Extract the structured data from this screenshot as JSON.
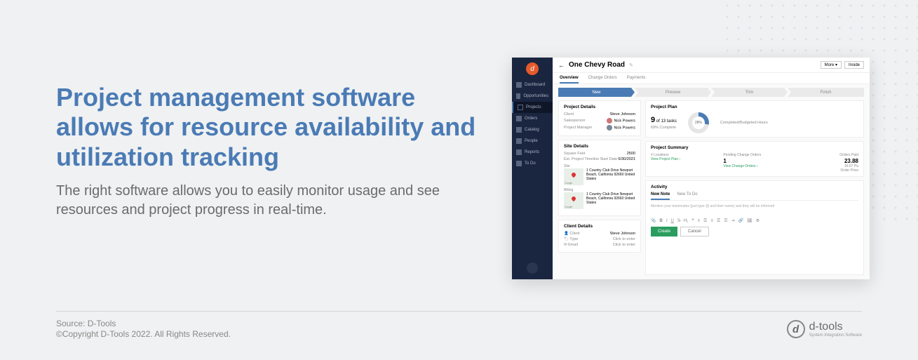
{
  "hero": {
    "headline": "Project management software allows for resource availability and utilization tracking",
    "subhead": "The right software allows you to easily monitor usage and see resources and project progress in real-time."
  },
  "sidebar": {
    "items": [
      {
        "label": "Dashboard"
      },
      {
        "label": "Opportunities"
      },
      {
        "label": "Projects"
      },
      {
        "label": "Orders"
      },
      {
        "label": "Catalog"
      },
      {
        "label": "People"
      },
      {
        "label": "Reports"
      },
      {
        "label": "To Do"
      }
    ]
  },
  "header": {
    "title": "One Chevy Road",
    "more": "More ▾",
    "inside": "Inside"
  },
  "tabs": {
    "overview": "Overview",
    "change_orders": "Change Orders",
    "payments": "Payments"
  },
  "stages": [
    "New",
    "Preview",
    "Trim",
    "Finish"
  ],
  "project_details": {
    "title": "Project Details",
    "client_label": "Client",
    "client": "Steve Johnson",
    "sales_label": "Salesperson",
    "sales": "Nick Powers",
    "pm_label": "Project Manager",
    "pm": "Nick Powers"
  },
  "site_details": {
    "title": "Site Details",
    "sqft_label": "Square Feet",
    "sqft": "2500",
    "timeline_label": "Est. Project Timeline",
    "start_label": "Start Date",
    "start": "6/30/2021",
    "site_label": "Site",
    "billing_label": "Billing",
    "address": "1 Country Club Drive Newport Beach, California 92660 United States",
    "google": "Google"
  },
  "client_details": {
    "title": "Client Details",
    "client_label": "Client",
    "client": "Steve Johnson",
    "type_label": "Type",
    "type": "Click to enter",
    "email_label": "Email",
    "email": "Click to enter"
  },
  "plan": {
    "title": "Project Plan",
    "tasks_done": "9",
    "tasks_mid": " of ",
    "tasks_total": "13 tasks",
    "percent": "69% Complete",
    "donut": "28%",
    "label": "Completed/Budgeted Hours"
  },
  "summary": {
    "title": "Project Summary",
    "loc_label": "# Locations",
    "loc_link": "View Project Plan",
    "pending_label": "Pending Change Orders",
    "pending_val": "1",
    "pending_link": "View Change Orders",
    "paid_label": "Orders Paid",
    "paid_val": "23.88",
    "paid_sub": "16.57 Pa",
    "paid_note": "Order Price"
  },
  "activity": {
    "title": "Activity",
    "tab_note": "New Note",
    "tab_todo": "New To Do",
    "hint": "Mention your teammates (just type @ and their name) and they will be informed",
    "create": "Create",
    "cancel": "Cancel"
  },
  "footer": {
    "source": "Source: D-Tools",
    "copyright": "©Copyright D-Tools 2022. All Rights Reserved.",
    "brand": "d-tools",
    "tagline": "System Integration Software"
  }
}
